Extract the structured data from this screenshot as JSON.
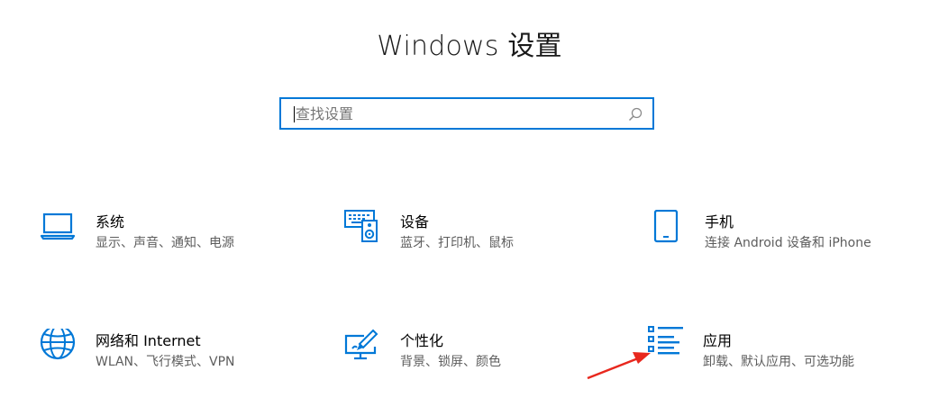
{
  "window": {
    "title": "Windows 设置"
  },
  "search": {
    "placeholder": "查找设置",
    "value": ""
  },
  "tiles": [
    {
      "icon": "laptop-icon",
      "title": "系统",
      "subtitle": "显示、声音、通知、电源"
    },
    {
      "icon": "keyboard-speaker-icon",
      "title": "设备",
      "subtitle": "蓝牙、打印机、鼠标"
    },
    {
      "icon": "phone-icon",
      "title": "手机",
      "subtitle": "连接 Android 设备和 iPhone"
    },
    {
      "icon": "globe-icon",
      "title": "网络和 Internet",
      "subtitle": "WLAN、飞行模式、VPN"
    },
    {
      "icon": "monitor-brush-icon",
      "title": "个性化",
      "subtitle": "背景、锁屏、颜色"
    },
    {
      "icon": "apps-list-icon",
      "title": "应用",
      "subtitle": "卸载、默认应用、可选功能"
    }
  ],
  "colors": {
    "accent": "#0078d7",
    "annotation_arrow": "#e8281e",
    "subtitle": "#5d5d5d"
  }
}
